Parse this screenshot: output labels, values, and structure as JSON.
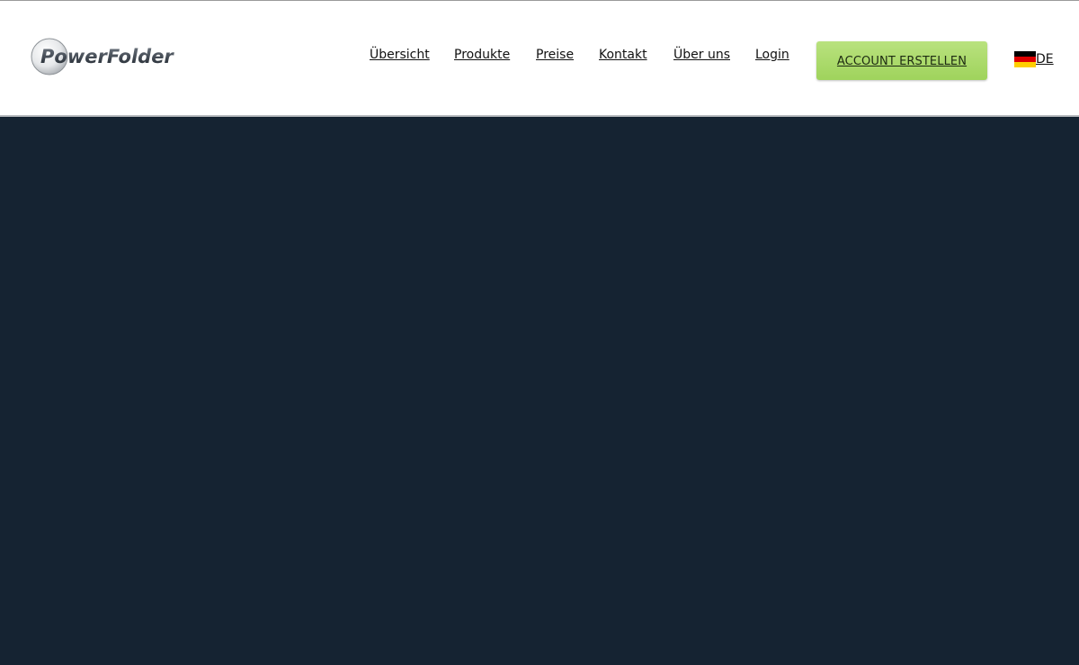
{
  "brand": {
    "name": "PowerFolder"
  },
  "nav": {
    "items": [
      {
        "label": "Übersicht"
      },
      {
        "label": "Produkte"
      },
      {
        "label": "Preise"
      },
      {
        "label": "Kontakt"
      },
      {
        "label": "Über uns"
      },
      {
        "label": "Login"
      }
    ],
    "cta_label": "ACCOUNT ERSTELLEN",
    "language": {
      "code": "DE",
      "flag_icon": "germany-flag-icon"
    }
  },
  "colors": {
    "header_bg": "#ffffff",
    "main_bg": "#152332",
    "cta_bg": "#a9d86a",
    "link": "#111111"
  }
}
